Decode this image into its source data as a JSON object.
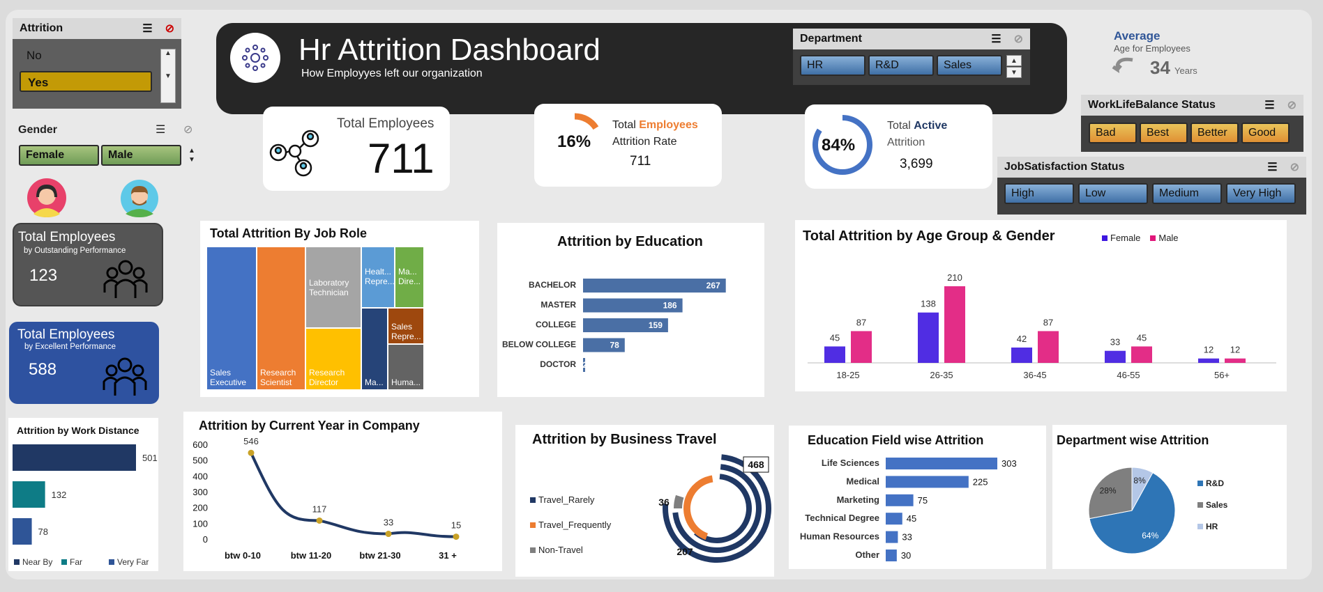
{
  "header": {
    "title": "Hr Attrition Dashboard",
    "subtitle": "How Employyes left our organization"
  },
  "attrition_slicer": {
    "title": "Attrition",
    "items": [
      "No",
      "Yes"
    ],
    "selected": "Yes"
  },
  "gender_slicer": {
    "title": "Gender",
    "items": [
      "Female",
      "Male"
    ]
  },
  "department_slicer": {
    "title": "Department",
    "items": [
      "HR",
      "R&D",
      "Sales"
    ]
  },
  "worklife_slicer": {
    "title": "WorkLifeBalance Status",
    "items": [
      "Bad",
      "Best",
      "Better",
      "Good"
    ]
  },
  "jobsat_slicer": {
    "title": "JobSatisfaction Status",
    "items": [
      "High",
      "Low",
      "Medium",
      "Very High"
    ]
  },
  "average_age": {
    "label": "Average",
    "sub": "Age for Employees",
    "value": "34",
    "unit": "Years"
  },
  "kpi_total": {
    "label": "Total Employees",
    "value": "711"
  },
  "kpi_rate": {
    "percent": "16%",
    "percent_value": 16,
    "label_a": "Total ",
    "label_b": "Employees",
    "label_c": "Attrition Rate",
    "value": "711"
  },
  "kpi_active": {
    "percent": "84%",
    "percent_value": 84,
    "label_a": "Total ",
    "label_b": "Active",
    "label_c": "Attrition",
    "value": "3,699"
  },
  "outstanding": {
    "title": "Total Employees",
    "sub": "by Outstanding Performance",
    "value": "123"
  },
  "excellent": {
    "title": "Total Employees",
    "sub": "by Excellent Performance",
    "value": "588"
  },
  "colors": {
    "dark": "#262626",
    "blue": "#4472c4",
    "orange": "#ed7d31",
    "navy": "#203864",
    "teal": "#0e7c86",
    "female": "#3d16e0",
    "male": "#e0167a"
  },
  "chart_data": [
    {
      "type": "treemap",
      "title": "Total Attrition By Job Role",
      "items": [
        {
          "label": "Sales Executive",
          "color": "#4472c4"
        },
        {
          "label": "Research Scientist",
          "color": "#ed7d31"
        },
        {
          "label": "Laboratory Technician",
          "color": "#a5a5a5"
        },
        {
          "label": "Research Director",
          "color": "#ffc000"
        },
        {
          "label": "Healt... Repre...",
          "color": "#5b9bd5"
        },
        {
          "label": "Ma... Dire...",
          "color": "#70ad47"
        },
        {
          "label": "Ma...",
          "color": "#264478"
        },
        {
          "label": "Sales Repre...",
          "color": "#9e480e"
        },
        {
          "label": "Huma...",
          "color": "#636363"
        }
      ]
    },
    {
      "type": "bar",
      "title": "Attrition by Education",
      "categories": [
        "BACHELOR",
        "MASTER",
        "COLLEGE",
        "BELOW COLLEGE",
        "DOCTOR"
      ],
      "values": [
        267,
        186,
        159,
        78,
        2
      ]
    },
    {
      "type": "bar",
      "title": "Total Attrition by Age Group & Gender",
      "categories": [
        "18-25",
        "26-35",
        "36-45",
        "46-55",
        "56+"
      ],
      "series": [
        {
          "name": "Female",
          "values": [
            45,
            138,
            42,
            33,
            12
          ]
        },
        {
          "name": "Male",
          "values": [
            87,
            210,
            87,
            45,
            12
          ]
        }
      ]
    },
    {
      "type": "bar",
      "title": "Attrition by Work Distance",
      "categories": [
        "Near By",
        "Far",
        "Very Far"
      ],
      "values": [
        501,
        132,
        78
      ]
    },
    {
      "type": "line",
      "title": "Attrition by Current Year in Company",
      "categories": [
        "btw 0-10",
        "btw 11-20",
        "btw 21-30",
        "31 +"
      ],
      "values": [
        546,
        117,
        33,
        15
      ],
      "yticks": [
        "600",
        "500",
        "400",
        "300",
        "200",
        "100",
        "0"
      ],
      "ylim": [
        0,
        600
      ]
    },
    {
      "type": "donut",
      "title": "Attrition by Business Travel",
      "series": [
        {
          "name": "Travel_Rarely",
          "value": 468
        },
        {
          "name": "Travel_Frequently",
          "value": 207
        },
        {
          "name": "Non-Travel",
          "value": 36
        }
      ]
    },
    {
      "type": "bar",
      "title": "Education Field wise Attrition",
      "categories": [
        "Life Sciences",
        "Medical",
        "Marketing",
        "Technical Degree",
        "Human Resources",
        "Other"
      ],
      "values": [
        303,
        225,
        75,
        45,
        33,
        30
      ]
    },
    {
      "type": "pie",
      "title": "Department wise Attrition",
      "slices": [
        {
          "name": "R&D",
          "value": 64,
          "label": "64%"
        },
        {
          "name": "Sales",
          "value": 28,
          "label": "28%"
        },
        {
          "name": "HR",
          "value": 8,
          "label": "8%"
        }
      ]
    }
  ]
}
